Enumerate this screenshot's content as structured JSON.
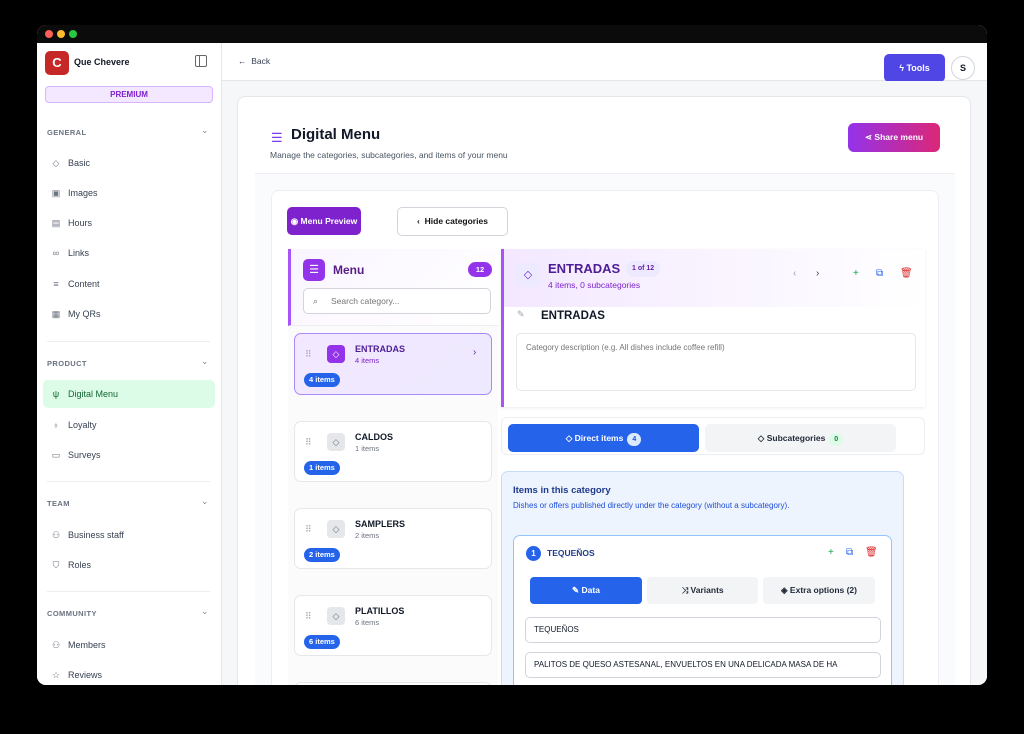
{
  "app": {
    "brand": "Que Chevere",
    "plan": "PREMIUM",
    "logo_letter": "C"
  },
  "sidebar": {
    "sections": [
      {
        "title": "GENERAL",
        "items": [
          {
            "label": "Basic",
            "icon": "tag-icon"
          },
          {
            "label": "Images",
            "icon": "image-icon"
          },
          {
            "label": "Hours",
            "icon": "calendar-icon"
          },
          {
            "label": "Links",
            "icon": "link-icon"
          },
          {
            "label": "Content",
            "icon": "list-icon"
          },
          {
            "label": "My QRs",
            "icon": "qr-icon"
          }
        ]
      },
      {
        "title": "PRODUCT",
        "items": [
          {
            "label": "Digital Menu",
            "icon": "utensils-icon",
            "active": true
          },
          {
            "label": "Loyalty",
            "icon": "award-icon"
          },
          {
            "label": "Surveys",
            "icon": "clipboard-icon"
          }
        ]
      },
      {
        "title": "TEAM",
        "items": [
          {
            "label": "Business staff",
            "icon": "users-cog-icon"
          },
          {
            "label": "Roles",
            "icon": "shield-icon"
          }
        ]
      },
      {
        "title": "COMMUNITY",
        "items": [
          {
            "label": "Members",
            "icon": "users-icon"
          },
          {
            "label": "Reviews",
            "icon": "star-icon"
          }
        ]
      }
    ]
  },
  "topbar": {
    "back": "Back",
    "tools": "Tools",
    "avatar": "S"
  },
  "page": {
    "title": "Digital Menu",
    "subtitle": "Manage the categories, subcategories, and items of your menu",
    "share": "Share menu"
  },
  "toolbar": {
    "preview": "Menu Preview",
    "hide": "Hide categories"
  },
  "menu": {
    "label": "Menu",
    "count": "12",
    "search_placeholder": "Search category..."
  },
  "categories": [
    {
      "name": "ENTRADAS",
      "items": "4 items",
      "badge": "4 items",
      "selected": true
    },
    {
      "name": "CALDOS",
      "items": "1 items",
      "badge": "1 items"
    },
    {
      "name": "SAMPLERS",
      "items": "2 items",
      "badge": "2 items"
    },
    {
      "name": "PLATILLOS",
      "items": "6 items",
      "badge": "6 items"
    }
  ],
  "detail": {
    "name": "ENTRADAS",
    "position": "1 of 12",
    "summary": "4 items, 0 subcategories",
    "name_value": "ENTRADAS",
    "desc_placeholder": "Category description (e.g. All dishes include coffee refill)"
  },
  "tabs": {
    "direct": "Direct items",
    "direct_count": "4",
    "sub": "Subcategories",
    "sub_count": "0"
  },
  "items_section": {
    "title": "Items in this category",
    "subtitle": "Dishes or offers published directly under the category (without a subcategory)."
  },
  "item": {
    "number": "1",
    "name": "TEQUEÑOS",
    "tab_data": "Data",
    "tab_variants": "Variants",
    "tab_extra": "Extra options (2)",
    "field_name": "TEQUEÑOS",
    "field_desc": "PALITOS DE QUESO ASTESANAL, ENVUELTOS EN UNA DELICADA MASA DE HA"
  },
  "colors": {
    "accent_purple": "#9333ea",
    "accent_blue": "#2563eb",
    "tools": "#4f46e5",
    "active_nav": "#dcfce7",
    "logo": "#c62828"
  }
}
